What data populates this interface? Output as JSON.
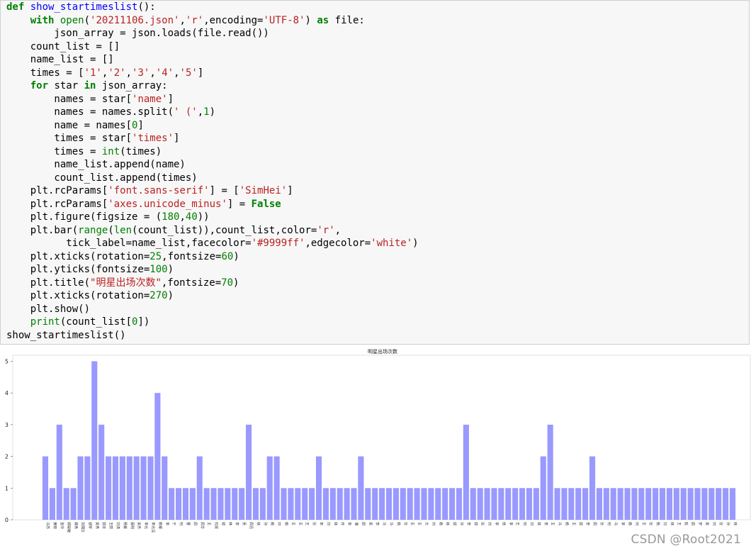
{
  "code_lines": [
    [
      {
        "t": "def ",
        "c": "kw"
      },
      {
        "t": "show_startimeslist",
        "c": "fn"
      },
      {
        "t": "():"
      }
    ],
    [
      {
        "t": "    "
      },
      {
        "t": "with ",
        "c": "kw"
      },
      {
        "t": "open",
        "c": "bi"
      },
      {
        "t": "("
      },
      {
        "t": "'20211106.json'",
        "c": "st"
      },
      {
        "t": ","
      },
      {
        "t": "'r'",
        "c": "st"
      },
      {
        "t": ",encoding="
      },
      {
        "t": "'UTF-8'",
        "c": "st"
      },
      {
        "t": ") "
      },
      {
        "t": "as ",
        "c": "kw"
      },
      {
        "t": "file:"
      }
    ],
    [
      {
        "t": "        json_array = json.loads(file.read())"
      }
    ],
    [
      {
        "t": "    count_list = []"
      }
    ],
    [
      {
        "t": "    name_list = []"
      }
    ],
    [
      {
        "t": "    times = ["
      },
      {
        "t": "'1'",
        "c": "st"
      },
      {
        "t": ","
      },
      {
        "t": "'2'",
        "c": "st"
      },
      {
        "t": ","
      },
      {
        "t": "'3'",
        "c": "st"
      },
      {
        "t": ","
      },
      {
        "t": "'4'",
        "c": "st"
      },
      {
        "t": ","
      },
      {
        "t": "'5'",
        "c": "st"
      },
      {
        "t": "]"
      }
    ],
    [
      {
        "t": "    "
      },
      {
        "t": "for ",
        "c": "kw"
      },
      {
        "t": "star "
      },
      {
        "t": "in ",
        "c": "kw"
      },
      {
        "t": "json_array:"
      }
    ],
    [
      {
        "t": "        names = star["
      },
      {
        "t": "'name'",
        "c": "st"
      },
      {
        "t": "]"
      }
    ],
    [
      {
        "t": "        names = names.split("
      },
      {
        "t": "' ('",
        "c": "st"
      },
      {
        "t": ","
      },
      {
        "t": "1",
        "c": "nu"
      },
      {
        "t": ")"
      }
    ],
    [
      {
        "t": "        name = names["
      },
      {
        "t": "0",
        "c": "nu"
      },
      {
        "t": "]"
      }
    ],
    [
      {
        "t": "        times = star["
      },
      {
        "t": "'times'",
        "c": "st"
      },
      {
        "t": "]"
      }
    ],
    [
      {
        "t": "        times = "
      },
      {
        "t": "int",
        "c": "bi"
      },
      {
        "t": "(times)"
      }
    ],
    [
      {
        "t": "        name_list.append(name)"
      }
    ],
    [
      {
        "t": "        count_list.append(times)"
      }
    ],
    [
      {
        "t": "    plt.rcParams["
      },
      {
        "t": "'font.sans-serif'",
        "c": "st"
      },
      {
        "t": "] = ["
      },
      {
        "t": "'SimHei'",
        "c": "st"
      },
      {
        "t": "]"
      }
    ],
    [
      {
        "t": "    plt.rcParams["
      },
      {
        "t": "'axes.unicode_minus'",
        "c": "st"
      },
      {
        "t": "] = "
      },
      {
        "t": "False",
        "c": "kw"
      }
    ],
    [
      {
        "t": "    plt.figure(figsize = ("
      },
      {
        "t": "180",
        "c": "nu"
      },
      {
        "t": ","
      },
      {
        "t": "40",
        "c": "nu"
      },
      {
        "t": "))"
      }
    ],
    [
      {
        "t": "    plt.bar("
      },
      {
        "t": "range",
        "c": "bi"
      },
      {
        "t": "("
      },
      {
        "t": "len",
        "c": "bi"
      },
      {
        "t": "(count_list)),count_list,color="
      },
      {
        "t": "'r'",
        "c": "st"
      },
      {
        "t": ","
      }
    ],
    [
      {
        "t": "          tick_label=name_list,facecolor="
      },
      {
        "t": "'#9999ff'",
        "c": "st"
      },
      {
        "t": ",edgecolor="
      },
      {
        "t": "'white'",
        "c": "st"
      },
      {
        "t": ")"
      }
    ],
    [
      {
        "t": "    plt.xticks(rotation="
      },
      {
        "t": "25",
        "c": "nu"
      },
      {
        "t": ",fontsize="
      },
      {
        "t": "60",
        "c": "nu"
      },
      {
        "t": ")"
      }
    ],
    [
      {
        "t": "    plt.yticks(fontsize="
      },
      {
        "t": "100",
        "c": "nu"
      },
      {
        "t": ")"
      }
    ],
    [
      {
        "t": "    plt.title("
      },
      {
        "t": "\"明星出场次数\"",
        "c": "st"
      },
      {
        "t": ",fontsize="
      },
      {
        "t": "70",
        "c": "nu"
      },
      {
        "t": ")"
      }
    ],
    [
      {
        "t": "    plt.xticks(rotation="
      },
      {
        "t": "270",
        "c": "nu"
      },
      {
        "t": ")"
      }
    ],
    [
      {
        "t": "    plt.show()"
      }
    ],
    [
      {
        "t": "    "
      },
      {
        "t": "print",
        "c": "bi"
      },
      {
        "t": "(count_list["
      },
      {
        "t": "0",
        "c": "nu"
      },
      {
        "t": "])"
      }
    ],
    [
      {
        "t": "show_startimeslist()"
      }
    ]
  ],
  "chart_data": {
    "type": "bar",
    "title": "明星出场次数",
    "bar_color": "#9999ff",
    "ylim": [
      0,
      5.3
    ],
    "yticks": [
      0,
      1,
      2,
      3,
      4,
      5
    ],
    "values": [
      2,
      1,
      3,
      1,
      1,
      2,
      2,
      5,
      3,
      2,
      2,
      2,
      2,
      2,
      2,
      2,
      4,
      2,
      1,
      1,
      1,
      1,
      2,
      1,
      1,
      1,
      1,
      1,
      1,
      3,
      1,
      1,
      2,
      2,
      1,
      1,
      1,
      1,
      1,
      2,
      1,
      1,
      1,
      1,
      1,
      2,
      1,
      1,
      1,
      1,
      1,
      1,
      1,
      1,
      1,
      1,
      1,
      1,
      1,
      1,
      3,
      1,
      1,
      1,
      1,
      1,
      1,
      1,
      1,
      1,
      1,
      2,
      3,
      1,
      1,
      1,
      1,
      1,
      2,
      1,
      1,
      1,
      1,
      1,
      1,
      1,
      1,
      1,
      1,
      1,
      1,
      1,
      1,
      1,
      1,
      1,
      1,
      1,
      1
    ],
    "categories": [
      "马苏",
      "黄晓",
      "金玲",
      "郭晓敏",
      "龚秀",
      "张国立",
      "胡军",
      "吴秀",
      "郭京",
      "王丽",
      "刘涛",
      "杨紫",
      "蔡明",
      "宋丹",
      "李光",
      "李光洁",
      "杨幂",
      "李",
      "于",
      "何",
      "曹",
      "周",
      "周华",
      "王",
      "何炅",
      "郭",
      "林",
      "李",
      "吴",
      "周迅",
      "林",
      "孙",
      "杨",
      "刘",
      "杨",
      "王",
      "王",
      "王",
      "张",
      "宋",
      "刘",
      "林",
      "乔",
      "李",
      "潘",
      "周",
      "吴",
      "李",
      "马",
      "马",
      "杨",
      "张",
      "王",
      "王",
      "大",
      "刘",
      "杨",
      "林",
      "郭",
      "孙",
      "李",
      "郭",
      "张",
      "刘",
      "李",
      "徐",
      "李",
      "王",
      "何",
      "刘",
      "林",
      "李",
      "王",
      "马",
      "杨",
      "王",
      "郭",
      "李",
      "周",
      "张",
      "何",
      "马",
      "李",
      "杨",
      "刘",
      "王",
      "张",
      "杨",
      "刘",
      "林",
      "王",
      "陈",
      "周",
      "罗",
      "吴",
      "刘",
      "张",
      "孙",
      "林"
    ]
  },
  "watermark": "CSDN @Root2021"
}
